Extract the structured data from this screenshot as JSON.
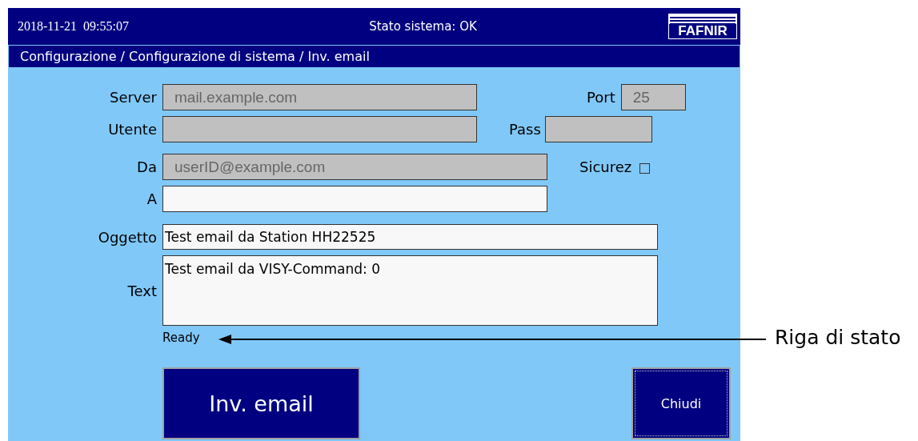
{
  "header": {
    "datetime": "2018-11-21  09:55:07",
    "system_status": "Stato sistema: OK",
    "logo": "FAFNIR"
  },
  "breadcrumb": "Configurazione / Configurazione di sistema / Inv. email",
  "form": {
    "server": {
      "label": "Server",
      "value": "mail.example.com",
      "disabled": true
    },
    "port": {
      "label": "Port",
      "value": "25",
      "disabled": true
    },
    "user": {
      "label": "Utente",
      "disabled": true
    },
    "pass": {
      "label": "Pass",
      "disabled": true
    },
    "from": {
      "label": "Da",
      "value": "userID@example.com",
      "disabled": true
    },
    "security": {
      "label": "Sicurez",
      "checked": false
    },
    "to": {
      "label": "A",
      "disabled": false
    },
    "subject": {
      "label": "Oggetto",
      "value": "Test email da Station HH22525",
      "disabled": false
    },
    "text": {
      "label": "Text",
      "value": "Test email da VISY-Command: 0",
      "disabled": false
    }
  },
  "status_line": "Ready",
  "buttons": [
    {
      "label": "Inv. email",
      "kind": "primary"
    },
    {
      "label": "Chiudi",
      "kind": "secondary"
    }
  ],
  "annotation": {
    "label": "Riga di stato"
  }
}
